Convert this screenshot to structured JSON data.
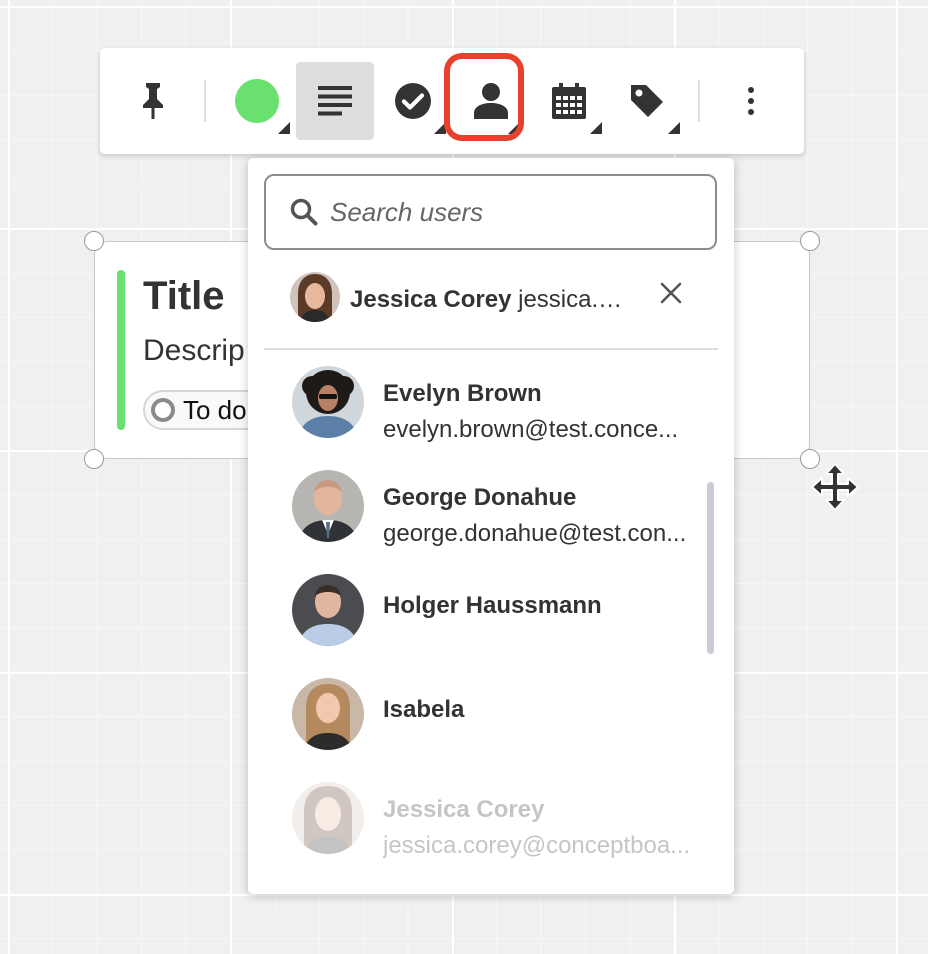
{
  "toolbar": {
    "buttons": [
      {
        "name": "pin",
        "icon": "pushpin-icon"
      },
      {
        "name": "color",
        "icon": "color-circle-icon",
        "color": "#6ae06f"
      },
      {
        "name": "text-style",
        "icon": "text-lines-icon",
        "active": true
      },
      {
        "name": "status",
        "icon": "check-circle-icon"
      },
      {
        "name": "assignee",
        "icon": "person-icon",
        "highlighted": true
      },
      {
        "name": "due-date",
        "icon": "calendar-icon"
      },
      {
        "name": "tags",
        "icon": "tag-icon"
      },
      {
        "name": "more",
        "icon": "vertical-dots-icon"
      }
    ],
    "highlight_color": "#e8402c"
  },
  "card": {
    "title": "Title",
    "description": "Descrip",
    "status": "To do",
    "accent_color": "#6ae06f"
  },
  "assignee_dropdown": {
    "search_placeholder": "Search users",
    "selected": {
      "name": "Jessica Corey",
      "email": "jessica.c..."
    },
    "users": [
      {
        "name": "Evelyn Brown",
        "email": "evelyn.brown@test.conce..."
      },
      {
        "name": "George Donahue",
        "email": "george.donahue@test.con..."
      },
      {
        "name": "Holger Haussmann",
        "email": ""
      },
      {
        "name": "Isabela",
        "email": ""
      },
      {
        "name": "Jessica Corey",
        "email": "jessica.corey@conceptboa...",
        "faded": true
      }
    ]
  }
}
